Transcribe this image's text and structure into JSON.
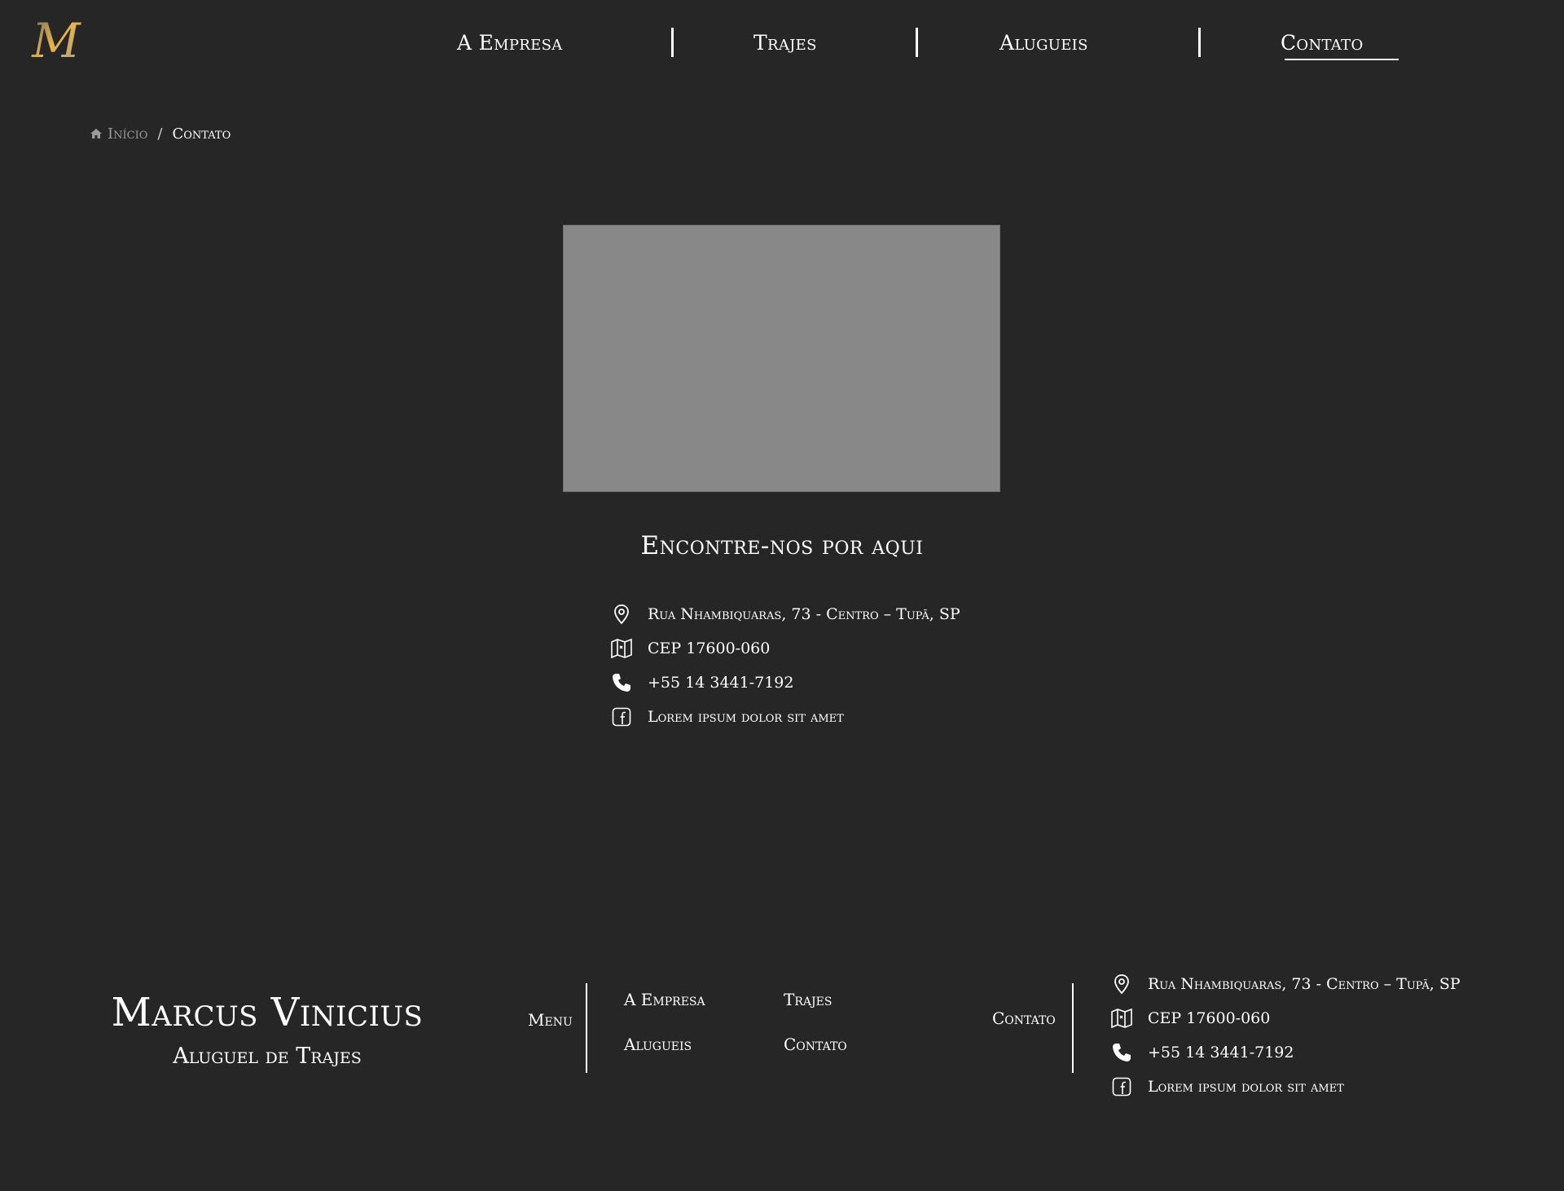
{
  "header": {
    "logo_letter": "M",
    "nav": [
      {
        "label": "A Empresa"
      },
      {
        "label": "Trajes"
      },
      {
        "label": "Alugueis"
      },
      {
        "label": "Contato"
      }
    ],
    "active": "Contato"
  },
  "breadcrumb": {
    "home": "Início",
    "separator": "/",
    "current": "Contato"
  },
  "map": {
    "placeholder_color": "#888888"
  },
  "contact": {
    "title": "Encontre-nos por aqui",
    "items": [
      {
        "icon": "location-pin-icon",
        "text": "Rua Nhambiquaras, 73 - Centro – Tupã, SP"
      },
      {
        "icon": "map-icon",
        "text": "CEP 17600-060"
      },
      {
        "icon": "phone-icon",
        "text": "+55 14 3441-7192"
      },
      {
        "icon": "facebook-icon",
        "text": "Lorem ipsum dolor sit amet"
      }
    ]
  },
  "footer": {
    "brand_name": "Marcus Vinicius",
    "brand_tagline": "Aluguel de Trajes",
    "menu_label": "Menu",
    "menu_links": [
      {
        "label": "A Empresa"
      },
      {
        "label": "Trajes"
      },
      {
        "label": "Alugueis"
      },
      {
        "label": "Contato"
      }
    ],
    "contact_label": "Contato",
    "contact_items": [
      {
        "icon": "location-pin-icon",
        "text": "Rua Nhambiquaras, 73 - Centro – Tupã, SP"
      },
      {
        "icon": "map-icon",
        "text": "CEP 17600-060"
      },
      {
        "icon": "phone-icon",
        "text": "+55 14 3441-7192"
      },
      {
        "icon": "facebook-icon",
        "text": "Lorem ipsum dolor sit amet"
      }
    ]
  },
  "colors": {
    "background": "#262626",
    "text": "#ffffff",
    "muted": "#9a9a9a",
    "logo_gold": "#e8b445"
  }
}
